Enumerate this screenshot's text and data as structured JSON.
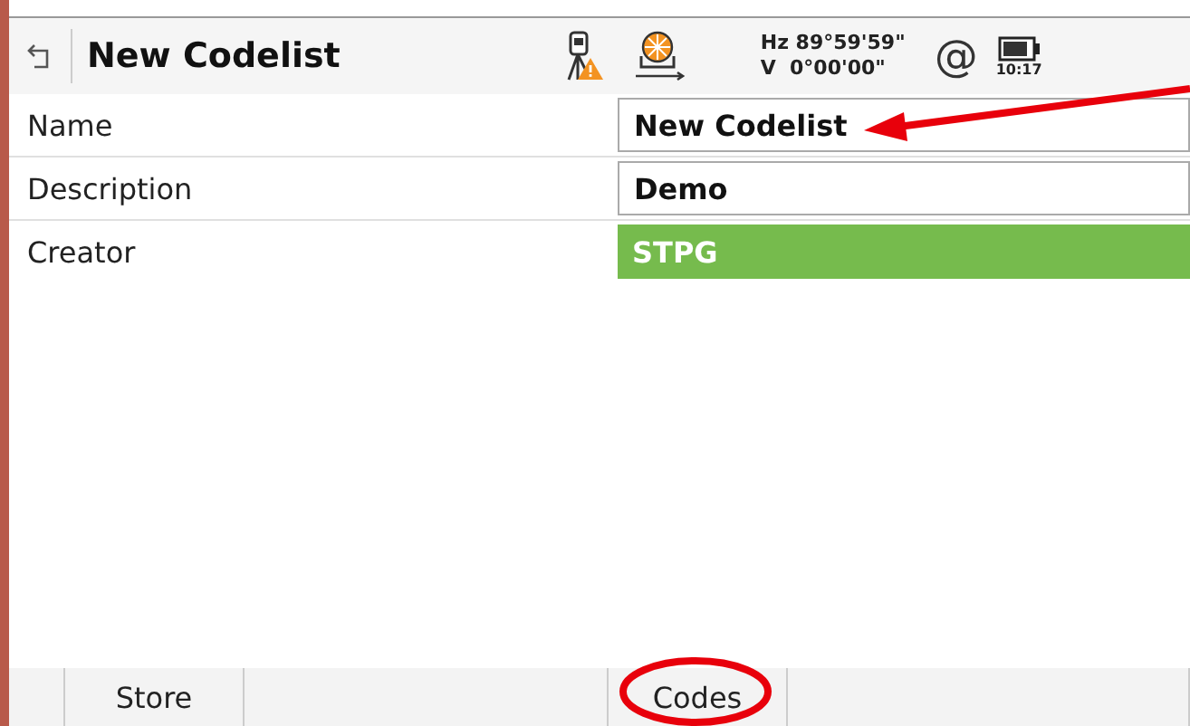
{
  "title_bar": {
    "title": "New Codelist",
    "angles": {
      "hz": "Hz 89°59'59\"",
      "v": "V  0°00'00\""
    },
    "interface": "@",
    "time": "10:17"
  },
  "fields": [
    {
      "label": "Name",
      "value": "New Codelist",
      "kind": "input"
    },
    {
      "label": "Description",
      "value": "Demo",
      "kind": "input"
    },
    {
      "label": "Creator",
      "value": "STPG",
      "kind": "display"
    }
  ],
  "softkeys": [
    {
      "label": "Store"
    },
    {
      "label": "Codes"
    }
  ],
  "annotations": {
    "arrow_to_name": true,
    "circle_on_codes": true
  }
}
